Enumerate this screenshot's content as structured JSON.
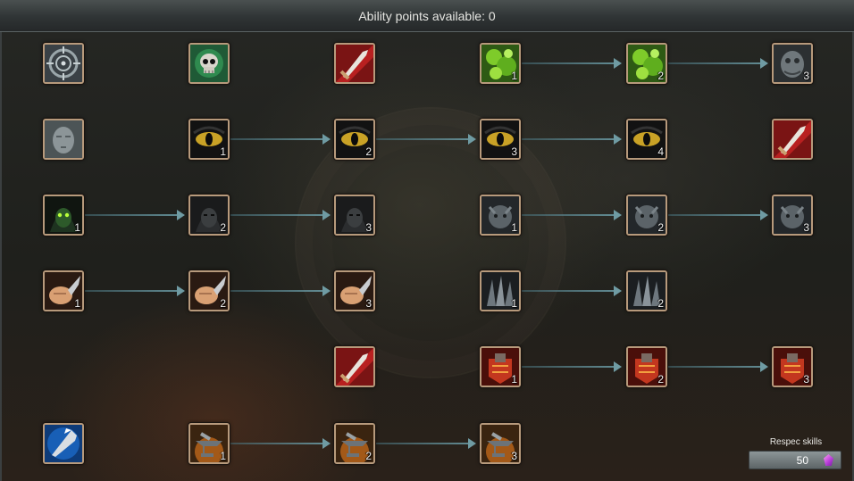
{
  "header": {
    "title": "Ability points available: 0"
  },
  "respec": {
    "label": "Respec skills",
    "cost": "50",
    "currency_icon": "purple-gem-icon"
  },
  "rows": [
    {
      "row": 1,
      "nodes": [
        {
          "name": "crosshair-target-skill",
          "icon": "crosshair-icon",
          "level": ""
        },
        {
          "name": "skull-emblem-skill",
          "icon": "skull-icon",
          "level": ""
        },
        {
          "name": "sword-slash-skill",
          "icon": "sword-slash-icon",
          "level": ""
        },
        {
          "name": "green-poison-skill",
          "icon": "green-poison-icon",
          "level": "1"
        },
        {
          "name": "green-poison-skill",
          "icon": "green-poison-icon",
          "level": "2"
        },
        {
          "name": "stone-creature-skill",
          "icon": "stone-creature-icon",
          "level": "3"
        }
      ]
    },
    {
      "row": 2,
      "nodes": [
        {
          "name": "stone-face-skill",
          "icon": "stone-face-icon",
          "level": ""
        },
        {
          "name": "beast-eye-skill",
          "icon": "eye-icon",
          "level": "1"
        },
        {
          "name": "beast-eye-skill",
          "icon": "eye-icon",
          "level": "2"
        },
        {
          "name": "beast-eye-skill",
          "icon": "eye-icon",
          "level": "3"
        },
        {
          "name": "beast-eye-skill",
          "icon": "eye-icon",
          "level": "4"
        },
        {
          "name": "sword-slash-skill",
          "icon": "sword-slash-icon",
          "level": ""
        }
      ]
    },
    {
      "row": 3,
      "nodes": [
        {
          "name": "hooded-goblin-skill",
          "icon": "hooded-goblin-icon",
          "level": "1"
        },
        {
          "name": "dark-hood-skill",
          "icon": "dark-hood-icon",
          "level": "2"
        },
        {
          "name": "dark-hood-skill",
          "icon": "dark-hood-icon",
          "level": "3"
        },
        {
          "name": "gray-beast-skill",
          "icon": "gray-beast-icon",
          "level": "1"
        },
        {
          "name": "gray-beast-skill",
          "icon": "gray-beast-icon",
          "level": "2"
        },
        {
          "name": "gray-beast-skill",
          "icon": "gray-beast-icon",
          "level": "3"
        }
      ]
    },
    {
      "row": 4,
      "nodes": [
        {
          "name": "fist-dagger-skill",
          "icon": "fist-dagger-icon",
          "level": "1"
        },
        {
          "name": "fist-dagger-skill",
          "icon": "fist-dagger-icon",
          "level": "2"
        },
        {
          "name": "fist-dagger-skill",
          "icon": "fist-dagger-icon",
          "level": "3"
        },
        {
          "name": "dark-claws-skill",
          "icon": "dark-claws-icon",
          "level": "1"
        },
        {
          "name": "dark-claws-skill",
          "icon": "dark-claws-icon",
          "level": "2"
        }
      ]
    },
    {
      "row": 5,
      "nodes": [
        {
          "name": "sword-slash-skill",
          "icon": "sword-slash-icon",
          "level": ""
        },
        {
          "name": "red-armor-skill",
          "icon": "red-armor-icon",
          "level": "1"
        },
        {
          "name": "red-armor-skill",
          "icon": "red-armor-icon",
          "level": "2"
        },
        {
          "name": "red-armor-skill",
          "icon": "red-armor-icon",
          "level": "3"
        }
      ]
    },
    {
      "row": 6,
      "nodes": [
        {
          "name": "blue-arrowhead-skill",
          "icon": "blue-arrowhead-icon",
          "level": ""
        },
        {
          "name": "anvil-forge-skill",
          "icon": "anvil-icon",
          "level": "1"
        },
        {
          "name": "anvil-forge-skill",
          "icon": "anvil-icon",
          "level": "2"
        },
        {
          "name": "anvil-forge-skill",
          "icon": "anvil-icon",
          "level": "3"
        }
      ]
    }
  ]
}
